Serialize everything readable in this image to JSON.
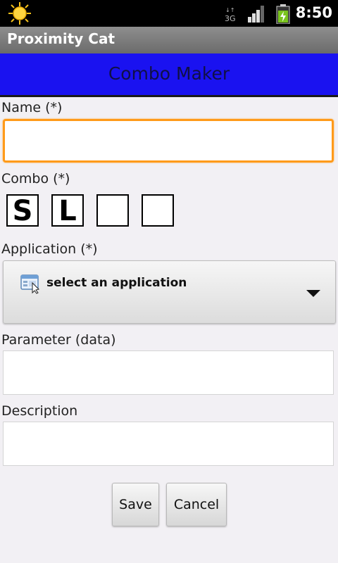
{
  "status_bar": {
    "time": "8:50",
    "network": "3G",
    "icons": [
      "weather-sun-icon",
      "network-3g-icon",
      "signal-bars-icon",
      "battery-charging-icon"
    ]
  },
  "app_title": "Proximity Cat",
  "header": {
    "title": "Combo Maker",
    "background_color": "#1a12f0"
  },
  "form": {
    "name_label": "Name (*)",
    "name_value": "",
    "combo_label": "Combo (*)",
    "combo_slots": [
      "S",
      "L",
      "",
      ""
    ],
    "application_label": "Application (*)",
    "application_value": "select an application",
    "application_icon": "app-window-icon",
    "parameter_label": "Parameter (data)",
    "parameter_value": "",
    "description_label": "Description",
    "description_value": ""
  },
  "buttons": {
    "save": "Save",
    "cancel": "Cancel"
  },
  "colors": {
    "focus_border": "#ff9a1a"
  }
}
